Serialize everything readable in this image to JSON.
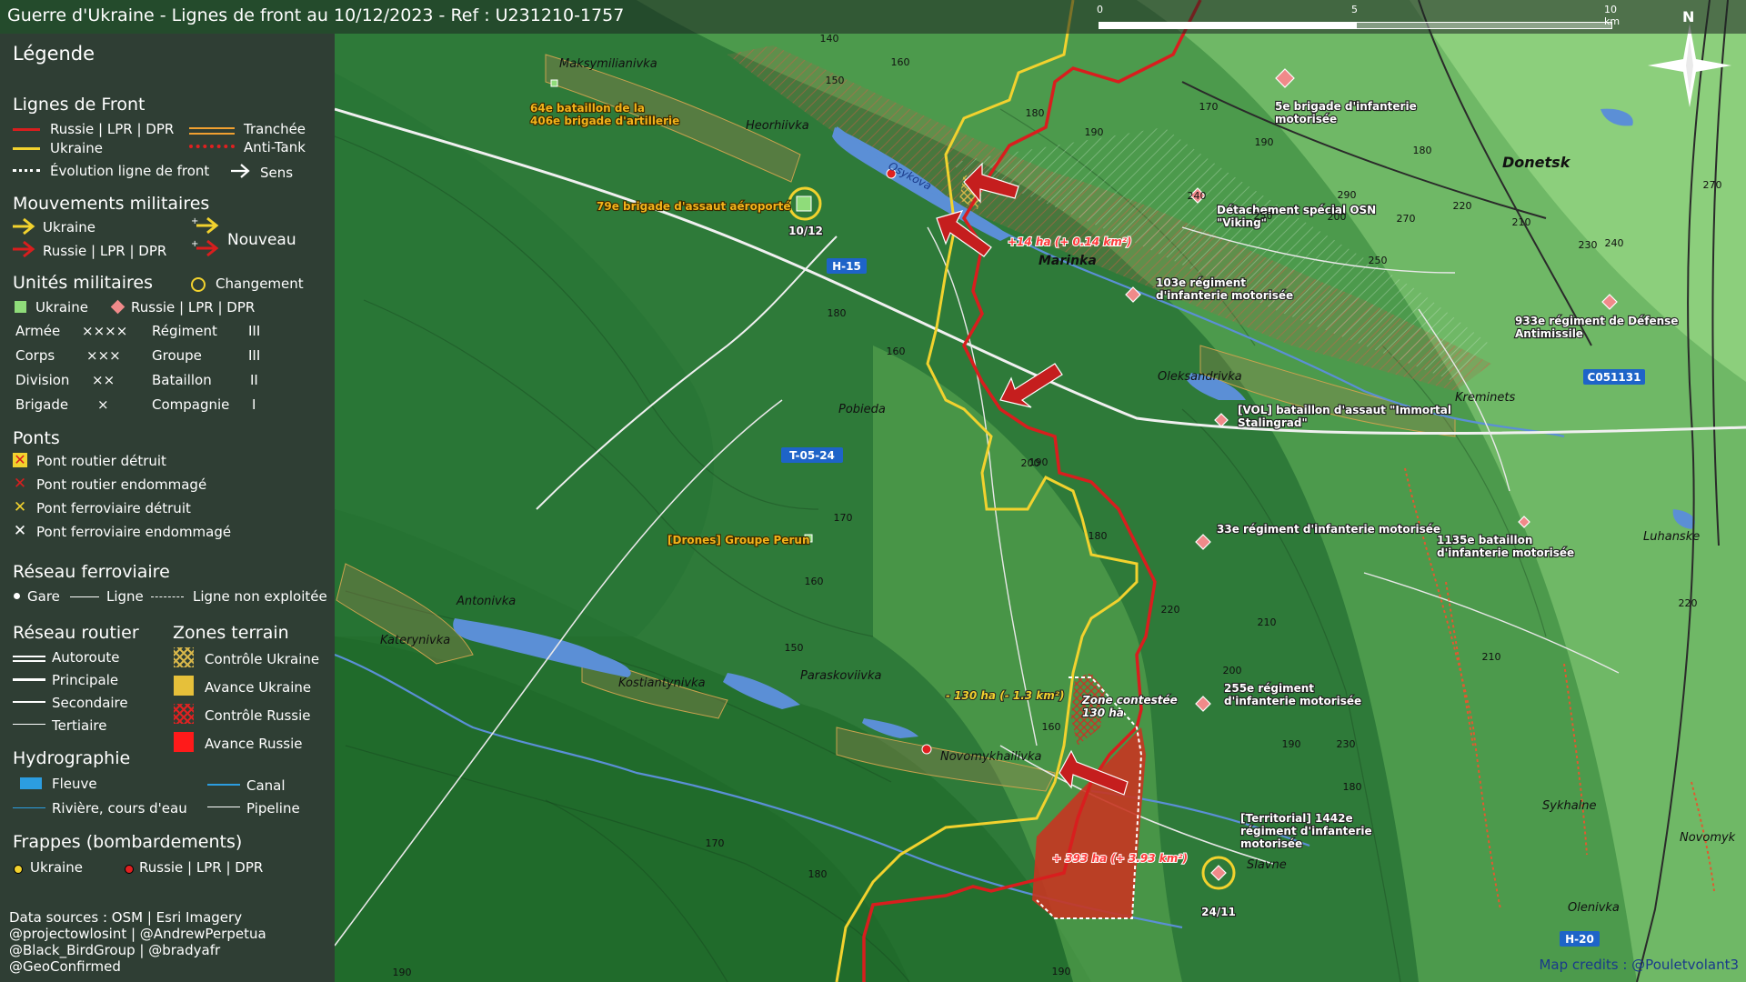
{
  "title": "Guerre d'Ukraine - Lignes de front au 10/12/2023 - Ref : U231210-1757",
  "scale": {
    "ticks": [
      "0",
      "5",
      "10 km"
    ]
  },
  "north": "N",
  "legend": {
    "heading": "Légende",
    "front": {
      "heading": "Lignes de Front",
      "russia": "Russie | LPR | DPR",
      "ukraine": "Ukraine",
      "evolution": "Évolution ligne de front",
      "trench": "Tranchée",
      "antitank": "Anti-Tank",
      "direction": "Sens"
    },
    "movements": {
      "heading": "Mouvements militaires",
      "ukraine": "Ukraine",
      "russia": "Russie | LPR | DPR",
      "new": "Nouveau"
    },
    "units": {
      "heading": "Unités militaires",
      "change": "Changement",
      "ukraine": "Ukraine",
      "russia": "Russie | LPR | DPR",
      "rows": [
        {
          "left": "Armée",
          "left_sym": "××××",
          "right": "Régiment",
          "right_sym": "III"
        },
        {
          "left": "Corps",
          "left_sym": "×××",
          "right": "Groupe",
          "right_sym": "III"
        },
        {
          "left": "Division",
          "left_sym": "××",
          "right": "Bataillon",
          "right_sym": "II"
        },
        {
          "left": "Brigade",
          "left_sym": "×",
          "right": "Compagnie",
          "right_sym": "I"
        }
      ]
    },
    "bridges": {
      "heading": "Ponts",
      "items": [
        "Pont routier détruit",
        "Pont routier endommagé",
        "Pont ferroviaire détruit",
        "Pont ferroviaire endommagé"
      ]
    },
    "rail": {
      "heading": "Réseau ferroviaire",
      "station": "Gare",
      "line": "Ligne",
      "unused": "Ligne non exploitée"
    },
    "roads": {
      "heading": "Réseau routier",
      "items": [
        "Autoroute",
        "Principale",
        "Secondaire",
        "Tertiaire"
      ]
    },
    "zones": {
      "heading": "Zones terrain",
      "items": [
        "Contrôle Ukraine",
        "Avance Ukraine",
        "Contrôle Russie",
        "Avance Russie"
      ]
    },
    "hydro": {
      "heading": "Hydrographie",
      "river": "Fleuve",
      "stream": "Rivière, cours d'eau",
      "canal": "Canal",
      "pipeline": "Pipeline"
    },
    "strikes": {
      "heading": "Frappes (bombardements)",
      "ukraine": "Ukraine",
      "russia": "Russie | LPR | DPR"
    }
  },
  "credits": [
    "Data sources : OSM | Esri Imagery",
    "@projectowlosint | @AndrewPerpetua",
    "@Black_BirdGroup | @bradyafr",
    "@GeoConfirmed"
  ],
  "map_credit": "Map credits : @Pouletvolant3",
  "places": [
    "Maksymilianivka",
    "Heorhiivka",
    "Marinka",
    "Pobieda",
    "Oleksandrivka",
    "Kreminets",
    "Donetsk",
    "Antonivka",
    "Katerynivka",
    "Kostiantynivka",
    "Paraskoviivka",
    "Novomykhailivka",
    "Slavne",
    "Sykhalne",
    "Olenivka",
    "Luhanske",
    "Novomyk",
    "Osykova"
  ],
  "roads": [
    "H-15",
    "T-05-24",
    "C051131",
    "H-20"
  ],
  "units": [
    "64e bataillon de la 406e brigade d'artillerie",
    "79e brigade d'assaut aéroporté",
    "10/12",
    "5e brigade d'infanterie motorisée",
    "Détachement spécial OSN \"Viking\"",
    "103e régiment d'infanterie motorisée",
    "933e régiment de Défense Antimissile",
    "[VOL] bataillon d'assaut \"Immortal Stalingrad\"",
    "33e régiment d'infanterie motorisée",
    "1135e bataillon d'infanterie motorisée",
    "[Drones] Groupe Perun",
    "255e régiment d'infanterie motorisée",
    "[Territorial] 1442e régiment d'infanterie motorisée",
    "24/11"
  ],
  "changes": [
    "+14 ha (+ 0.14 km²)",
    "- 130 ha (- 1.3 km²)",
    "Zone contestée 130 ha (1.3 km²)",
    "+ 393 ha (+ 3.93 km²)"
  ],
  "elevations": [
    "140",
    "160",
    "150",
    "180",
    "190",
    "170",
    "180",
    "290",
    "240",
    "250",
    "270",
    "220",
    "210",
    "230",
    "240",
    "270",
    "250",
    "200",
    "190",
    "180",
    "160",
    "190",
    "200",
    "180",
    "210",
    "170",
    "160",
    "150",
    "220",
    "210",
    "200",
    "220",
    "230",
    "180",
    "170",
    "180",
    "190",
    "160",
    "190",
    "190"
  ],
  "colors": {
    "russia": "#d81e1e",
    "ukraine": "#f2d22e",
    "water": "#5b8fd6",
    "land_dark": "#2f7a3a",
    "land_light": "#7cc46d"
  }
}
